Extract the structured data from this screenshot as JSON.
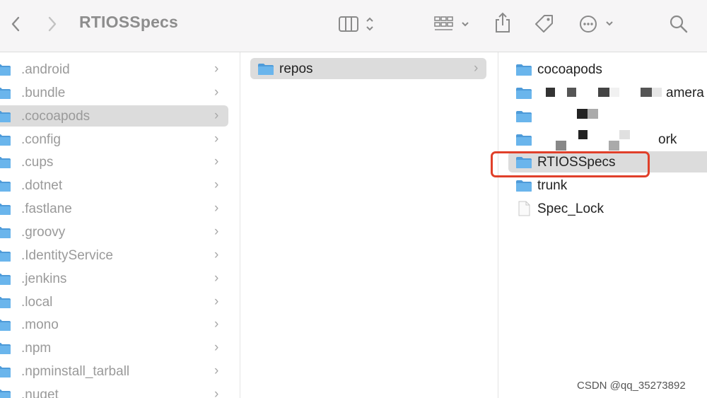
{
  "window": {
    "title": "RTIOSSpecs"
  },
  "toolbar": {
    "back_icon": "chevron-left-icon",
    "forward_icon": "chevron-right-icon",
    "view_icon": "column-view-icon",
    "group_icon": "group-grid-icon",
    "share_icon": "share-icon",
    "tag_icon": "tag-icon",
    "more_icon": "more-actions-icon",
    "search_icon": "search-icon"
  },
  "column1": {
    "items": [
      {
        "label": ".android"
      },
      {
        "label": ".bundle"
      },
      {
        "label": ".cocoapods",
        "selected": true
      },
      {
        "label": ".config"
      },
      {
        "label": ".cups"
      },
      {
        "label": ".dotnet"
      },
      {
        "label": ".fastlane"
      },
      {
        "label": ".groovy"
      },
      {
        "label": ".IdentityService"
      },
      {
        "label": ".jenkins"
      },
      {
        "label": ".local"
      },
      {
        "label": ".mono"
      },
      {
        "label": ".npm"
      },
      {
        "label": ".npminstall_tarball"
      },
      {
        "label": ".nuget"
      }
    ]
  },
  "column2": {
    "items": [
      {
        "label": "repos",
        "selected": true
      }
    ]
  },
  "column3": {
    "items": [
      {
        "label": "cocoapods",
        "kind": "folder"
      },
      {
        "label": "amera",
        "kind": "folder",
        "redacted": true
      },
      {
        "label": "",
        "kind": "folder",
        "redacted": true
      },
      {
        "label": "ork",
        "kind": "folder",
        "redacted": true
      },
      {
        "label": "RTIOSSpecs",
        "kind": "folder",
        "selected": true,
        "highlighted": true
      },
      {
        "label": "trunk",
        "kind": "folder"
      },
      {
        "label": "Spec_Lock",
        "kind": "file"
      }
    ]
  },
  "colors": {
    "folder": "#6ab5ec",
    "folder_dark": "#4e9bd9",
    "highlight": "#e0402a",
    "selection": "#dcdcdc"
  },
  "watermark": "CSDN @qq_35273892"
}
